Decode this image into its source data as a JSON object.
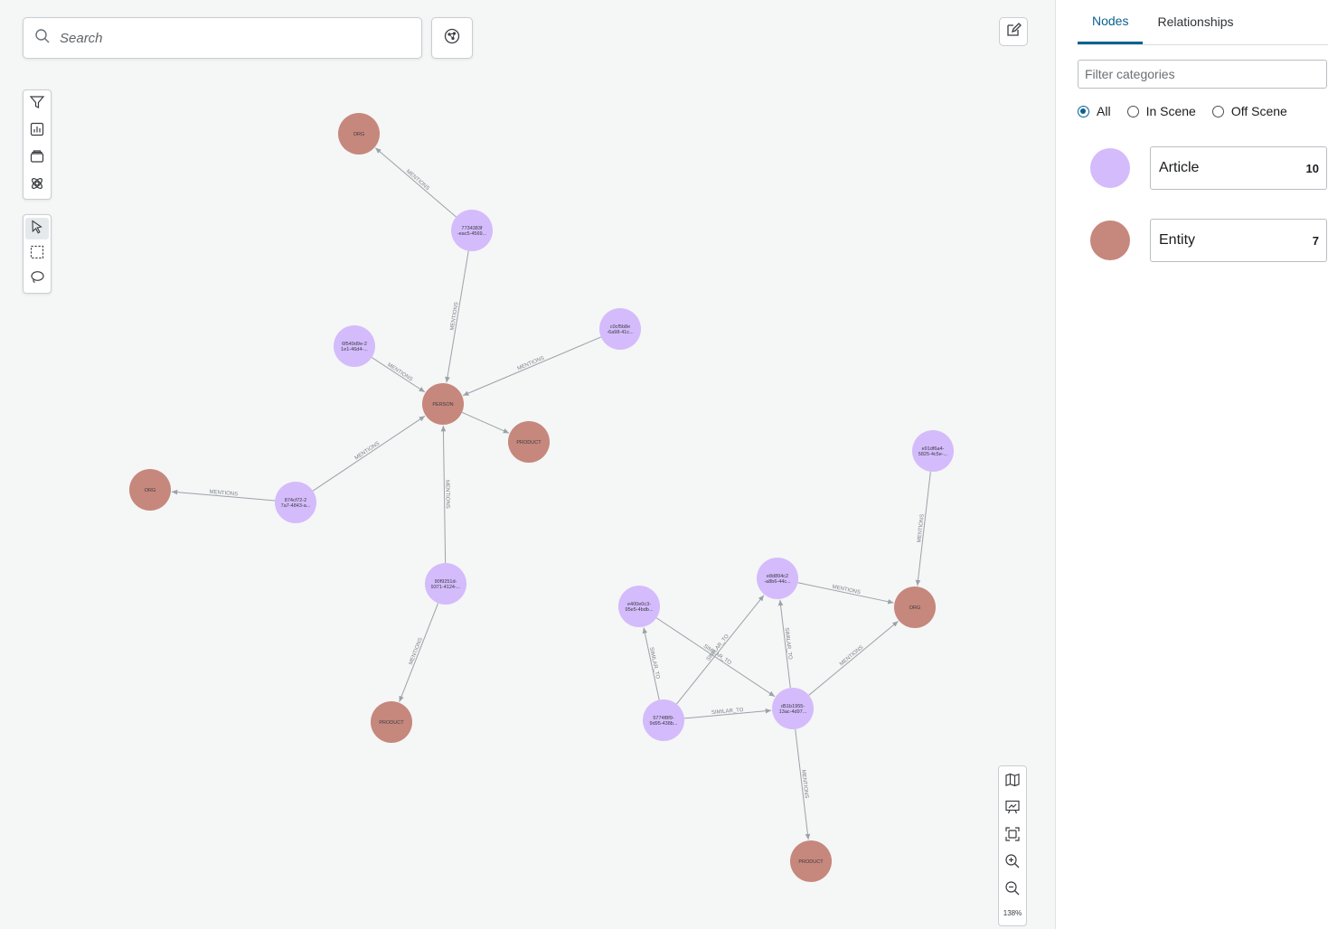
{
  "search": {
    "placeholder": "Search"
  },
  "zoom": {
    "level": "138%"
  },
  "toolbar_top": [
    {
      "name": "filter-icon"
    },
    {
      "name": "chart-icon"
    },
    {
      "name": "layers-icon"
    },
    {
      "name": "graph-style-icon"
    }
  ],
  "toolbar_select": [
    {
      "name": "pointer-select-icon",
      "active": true
    },
    {
      "name": "box-select-icon"
    },
    {
      "name": "lasso-select-icon"
    }
  ],
  "zoom_toolbar": [
    {
      "name": "map-icon"
    },
    {
      "name": "presentation-icon"
    },
    {
      "name": "fit-to-screen-icon"
    },
    {
      "name": "zoom-in-icon"
    },
    {
      "name": "zoom-out-icon"
    }
  ],
  "colors": {
    "article": "#d4bbfb",
    "entity": "#c6877c",
    "accent": "#0a6190"
  },
  "panel": {
    "tabs": [
      {
        "label": "Nodes",
        "active": true
      },
      {
        "label": "Relationships"
      }
    ],
    "filter_placeholder": "Filter categories",
    "radios": [
      {
        "label": "All",
        "checked": true
      },
      {
        "label": "In Scene"
      },
      {
        "label": "Off Scene"
      }
    ],
    "categories": [
      {
        "name": "Article",
        "count": "10",
        "color": "#d4bbfb"
      },
      {
        "name": "Entity",
        "count": "7",
        "color": "#c6877c"
      }
    ]
  },
  "graph": {
    "nodes": [
      {
        "id": "org1",
        "type": "entity",
        "label": [
          "ORG"
        ]
      },
      {
        "id": "a1",
        "type": "article",
        "label": [
          "7734383f",
          "-eac5-4569..."
        ]
      },
      {
        "id": "person",
        "type": "entity",
        "label": [
          "PERSON"
        ]
      },
      {
        "id": "a2",
        "type": "article",
        "label": [
          "6f549d9e-2",
          "1e1-46d4-..."
        ]
      },
      {
        "id": "a3",
        "type": "article",
        "label": [
          "c0cf5b8e",
          "-6a98-41c..."
        ]
      },
      {
        "id": "product1",
        "type": "entity",
        "label": [
          "PRODUCT"
        ]
      },
      {
        "id": "org2",
        "type": "entity",
        "label": [
          "ORG"
        ]
      },
      {
        "id": "a4",
        "type": "article",
        "label": [
          "874cf72-2",
          "7a7-4843-a..."
        ]
      },
      {
        "id": "a5",
        "type": "article",
        "label": [
          "90f9251d-",
          "9371-4124-..."
        ]
      },
      {
        "id": "product2",
        "type": "entity",
        "label": [
          "PRODUCT"
        ]
      },
      {
        "id": "a6",
        "type": "article",
        "label": [
          "e91df6a4-",
          "5825-4c5e-..."
        ]
      },
      {
        "id": "a7",
        "type": "article",
        "label": [
          "e8d894c2",
          "-a8b6-44c..."
        ]
      },
      {
        "id": "org3",
        "type": "entity",
        "label": [
          "ORG"
        ]
      },
      {
        "id": "a8",
        "type": "article",
        "label": [
          "e400e0c3-",
          "95e5-4bdb..."
        ]
      },
      {
        "id": "a9",
        "type": "article",
        "label": [
          "5774f8f9-",
          "9d95-438b..."
        ]
      },
      {
        "id": "a10",
        "type": "article",
        "label": [
          "d51b1955-",
          "13ac-4d97..."
        ]
      },
      {
        "id": "product3",
        "type": "entity",
        "label": [
          "PRODUCT"
        ]
      }
    ],
    "edges": [
      {
        "from": "a1",
        "to": "org1",
        "label": "MENTIONS"
      },
      {
        "from": "a1",
        "to": "person",
        "label": "MENTIONS"
      },
      {
        "from": "a2",
        "to": "person",
        "label": "MENTIONS"
      },
      {
        "from": "a3",
        "to": "person",
        "label": "MENTIONS"
      },
      {
        "from": "person",
        "to": "product1",
        "label": ""
      },
      {
        "from": "a4",
        "to": "person",
        "label": "MENTIONS"
      },
      {
        "from": "a4",
        "to": "org2",
        "label": "MENTIONS"
      },
      {
        "from": "a5",
        "to": "person",
        "label": "MENTIONS"
      },
      {
        "from": "a5",
        "to": "product2",
        "label": "MENTIONS"
      },
      {
        "from": "a6",
        "to": "org3",
        "label": "MENTIONS"
      },
      {
        "from": "a7",
        "to": "org3",
        "label": "MENTIONS"
      },
      {
        "from": "a10",
        "to": "org3",
        "label": "MENTIONS"
      },
      {
        "from": "a10",
        "to": "a7",
        "label": "SIMILAR_TO"
      },
      {
        "from": "a8",
        "to": "a10",
        "label": "SIMILAR_TO"
      },
      {
        "from": "a9",
        "to": "a8",
        "label": "SIMILAR_TO"
      },
      {
        "from": "a9",
        "to": "a7",
        "label": "SIMILAR_TO"
      },
      {
        "from": "a9",
        "to": "a10",
        "label": "SIMILAR_TO"
      },
      {
        "from": "a10",
        "to": "product3",
        "label": "MENTIONS"
      }
    ]
  }
}
